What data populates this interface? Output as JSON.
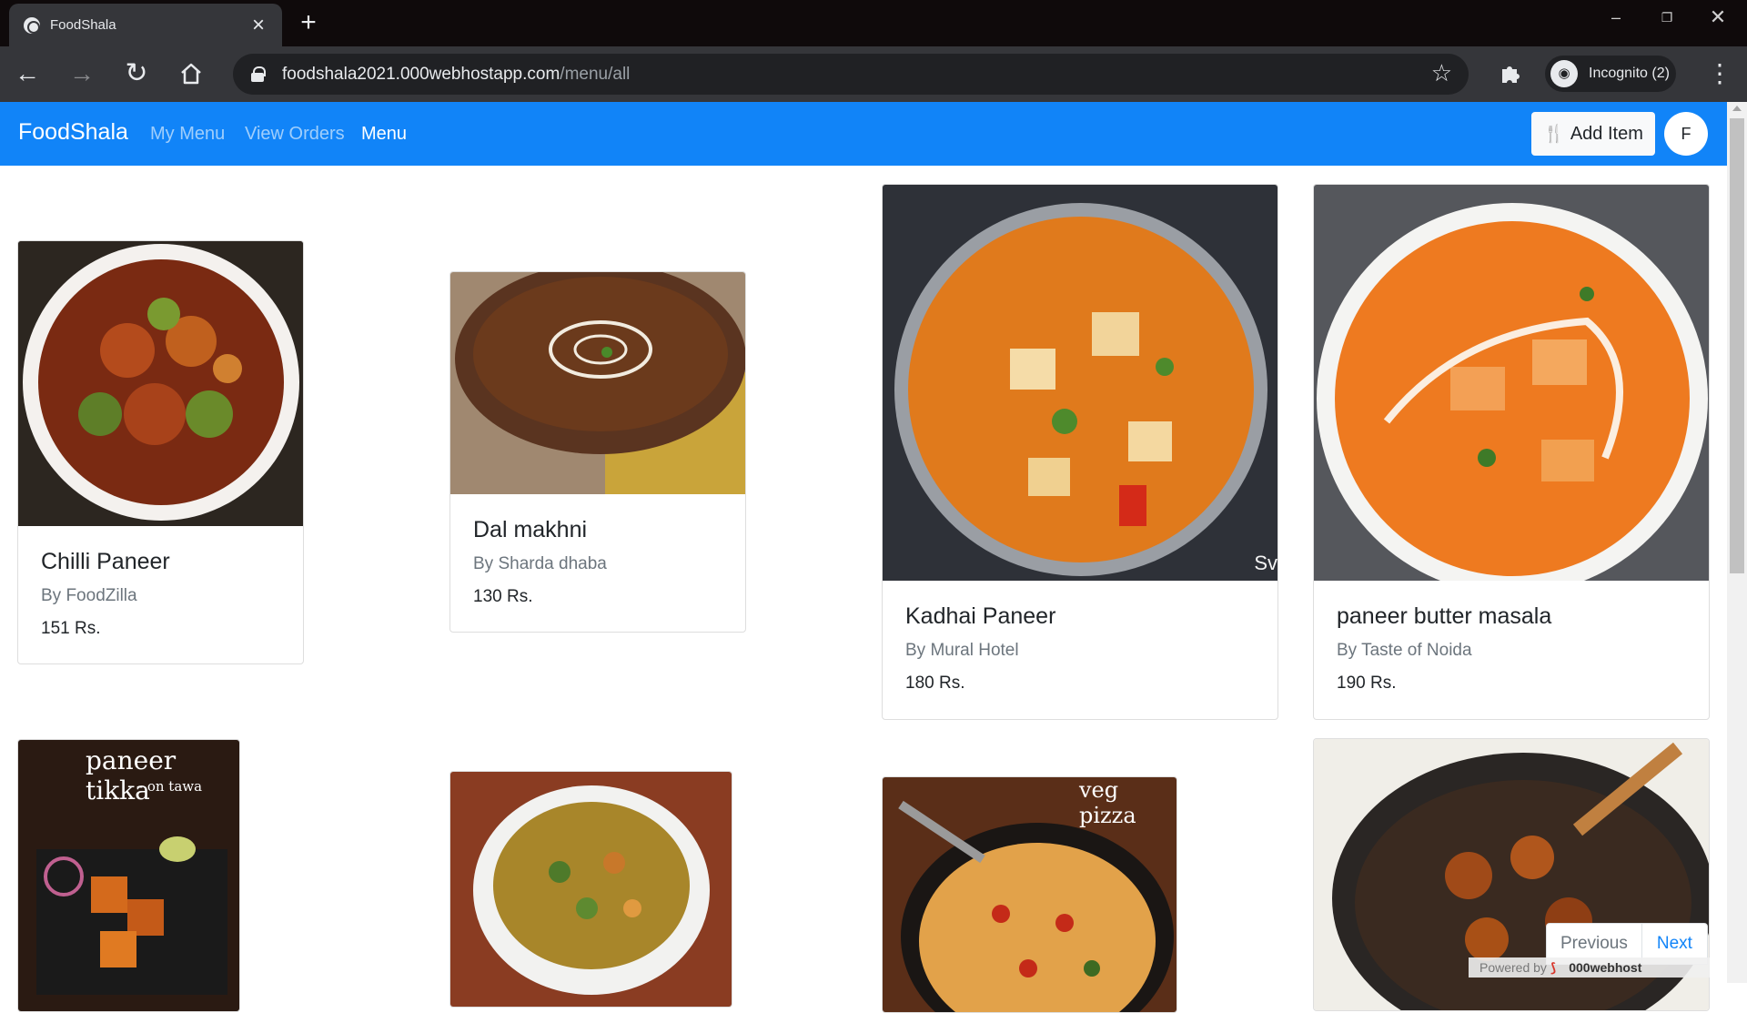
{
  "browser": {
    "tab_title": "FoodShala",
    "url_host": "foodshala2021.000webhostapp.com",
    "url_path": "/menu/all",
    "incognito_label": "Incognito (2)"
  },
  "navbar": {
    "brand": "FoodShala",
    "links": [
      "My Menu",
      "View Orders",
      "Menu"
    ],
    "active_link": "Menu",
    "add_item_label": "Add Item",
    "avatar_initial": "F"
  },
  "items": [
    {
      "name": "Chilli Paneer",
      "by": "By FoodZilla",
      "price": "151 Rs."
    },
    {
      "name": "Dal makhni",
      "by": "By Sharda dhaba",
      "price": "130 Rs."
    },
    {
      "name": "Kadhai Paneer",
      "by": "By Mural Hotel",
      "price": "180 Rs."
    },
    {
      "name": "paneer butter masala",
      "by": "By Taste of Noida",
      "price": "190 Rs."
    }
  ],
  "second_row_images": [
    {
      "caption_title": "paneer tikka",
      "caption_sub": "- on tawa"
    },
    {
      "caption_title": "",
      "caption_sub": ""
    },
    {
      "caption_title": "veg pizza",
      "caption_sub": ""
    },
    {
      "caption_title": "",
      "caption_sub": ""
    }
  ],
  "image_overlays": {
    "kadhai_watermark": "Sv"
  },
  "pagination": {
    "previous": "Previous",
    "next": "Next"
  },
  "footer_badge": {
    "powered_by": "Powered by",
    "host": "000webhost"
  },
  "colors": {
    "navbar": "#1184f8",
    "chrome_dark": "#35363a"
  }
}
